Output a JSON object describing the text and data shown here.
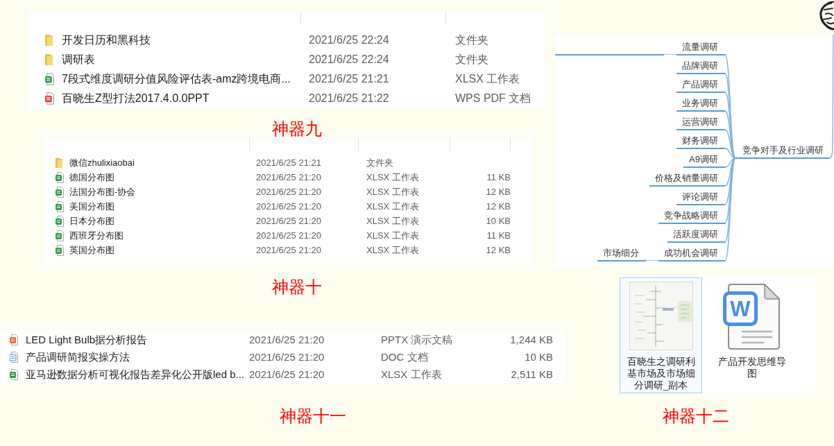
{
  "file_lists": [
    {
      "rows": [
        {
          "kind": "folder",
          "name": "开发日历和黑科技",
          "modified": "2021/6/25 22:24",
          "type": "文件夹"
        },
        {
          "kind": "folder",
          "name": "调研表",
          "modified": "2021/6/25 22:24",
          "type": "文件夹"
        },
        {
          "kind": "xlsx",
          "name": "7段式维度调研分值风险评估表-amz跨境电商...",
          "modified": "2021/6/25 21:21",
          "type": "XLSX 工作表"
        },
        {
          "kind": "pdf",
          "name": "百晓生Z型打法2017.4.0.0PPT",
          "modified": "2021/6/25 21:22",
          "type": "WPS PDF 文档"
        }
      ]
    },
    {
      "rows": [
        {
          "kind": "folder",
          "name": "微信zhulixiaobai",
          "modified": "2021/6/25 21:21",
          "type": "文件夹"
        },
        {
          "kind": "xlsx",
          "name": "德国分布图",
          "modified": "2021/6/25 21:20",
          "type": "XLSX 工作表",
          "size": "11 KB"
        },
        {
          "kind": "xlsx",
          "name": "法国分布图-协会",
          "modified": "2021/6/25 21:20",
          "type": "XLSX 工作表",
          "size": "12 KB"
        },
        {
          "kind": "xlsx",
          "name": "美国分布图",
          "modified": "2021/6/25 21:20",
          "type": "XLSX 工作表",
          "size": "12 KB"
        },
        {
          "kind": "xlsx",
          "name": "日本分布图",
          "modified": "2021/6/25 21:20",
          "type": "XLSX 工作表",
          "size": "10 KB"
        },
        {
          "kind": "xlsx",
          "name": "西班牙分布图",
          "modified": "2021/6/25 21:20",
          "type": "XLSX 工作表",
          "size": "11 KB"
        },
        {
          "kind": "xlsx",
          "name": "英国分布图",
          "modified": "2021/6/25 21:20",
          "type": "XLSX 工作表",
          "size": "12 KB"
        }
      ]
    },
    {
      "rows": [
        {
          "kind": "pptx",
          "name": "LED Light Bulb据分析报告",
          "modified": "2021/6/25 21:20",
          "type": "PPTX 演示文稿",
          "size": "1,244 KB"
        },
        {
          "kind": "doc",
          "name": "产品调研简报实操方法",
          "modified": "2021/6/25 21:20",
          "type": "DOC 文档",
          "size": "10 KB"
        },
        {
          "kind": "xlsx",
          "name": "亚马逊数据分析可视化报告差异化公开版led b...",
          "modified": "2021/6/25 21:20",
          "type": "XLSX 工作表",
          "size": "2,511 KB"
        }
      ]
    }
  ],
  "mind_map": {
    "central": "竞争对手及行业调研",
    "branches": [
      {
        "label": "流量调研",
        "expanded": true
      },
      {
        "label": "品牌调研",
        "expanded": false
      },
      {
        "label": "产品调研",
        "expanded": false
      },
      {
        "label": "业务调研",
        "expanded": false
      },
      {
        "label": "运营调研",
        "expanded": false
      },
      {
        "label": "财务调研",
        "expanded": false
      },
      {
        "label": "A9调研",
        "expanded": false
      },
      {
        "label": "价格及销量调研",
        "expanded": false
      },
      {
        "label": "评论调研",
        "expanded": false
      },
      {
        "label": "竞争战略调研",
        "expanded": false
      },
      {
        "label": "活跃度调研",
        "expanded": false
      },
      {
        "label": "成功机会调研",
        "expanded": true,
        "children": [
          {
            "label": "市场细分"
          }
        ]
      }
    ]
  },
  "icon_view": {
    "tiles": [
      {
        "kind": "image",
        "name": "百晓生之调研利基市场及市场细分调研_副本",
        "selected": true
      },
      {
        "kind": "word",
        "icon_letter": "W",
        "name": "产品开发思维导图",
        "selected": false
      }
    ]
  },
  "captions": [
    "神器九",
    "神器十",
    "神器十一",
    "神器十二"
  ]
}
